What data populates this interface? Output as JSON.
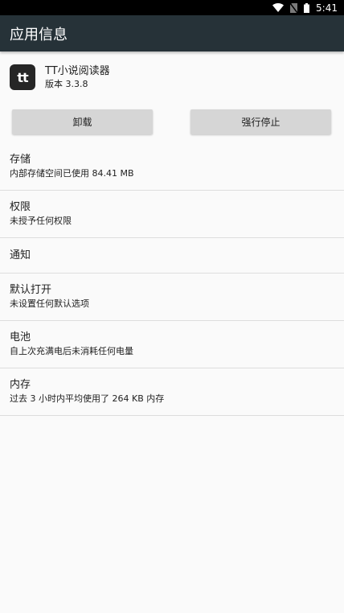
{
  "status_bar": {
    "time": "5:41",
    "icons": [
      "wifi-icon",
      "no-sim-icon",
      "battery-icon"
    ]
  },
  "app_bar": {
    "title": "应用信息"
  },
  "app": {
    "logo_text": "tt",
    "name": "TT小说阅读器",
    "version": "版本 3.3.8"
  },
  "buttons": {
    "uninstall": "卸载",
    "force_stop": "强行停止"
  },
  "items": [
    {
      "title": "存储",
      "subtitle": "内部存储空间已使用 84.41 MB"
    },
    {
      "title": "权限",
      "subtitle": "未授予任何权限"
    },
    {
      "title": "通知"
    },
    {
      "title": "默认打开",
      "subtitle": "未设置任何默认选项"
    },
    {
      "title": "电池",
      "subtitle": "自上次充满电后未消耗任何电量"
    },
    {
      "title": "内存",
      "subtitle": "过去 3 小时内平均使用了 264 KB 内存"
    }
  ],
  "colors": {
    "status_bar": "#000000",
    "app_bar": "#263238",
    "background": "#fafafa",
    "button": "#d6d6d6",
    "divider": "#dddddd"
  }
}
